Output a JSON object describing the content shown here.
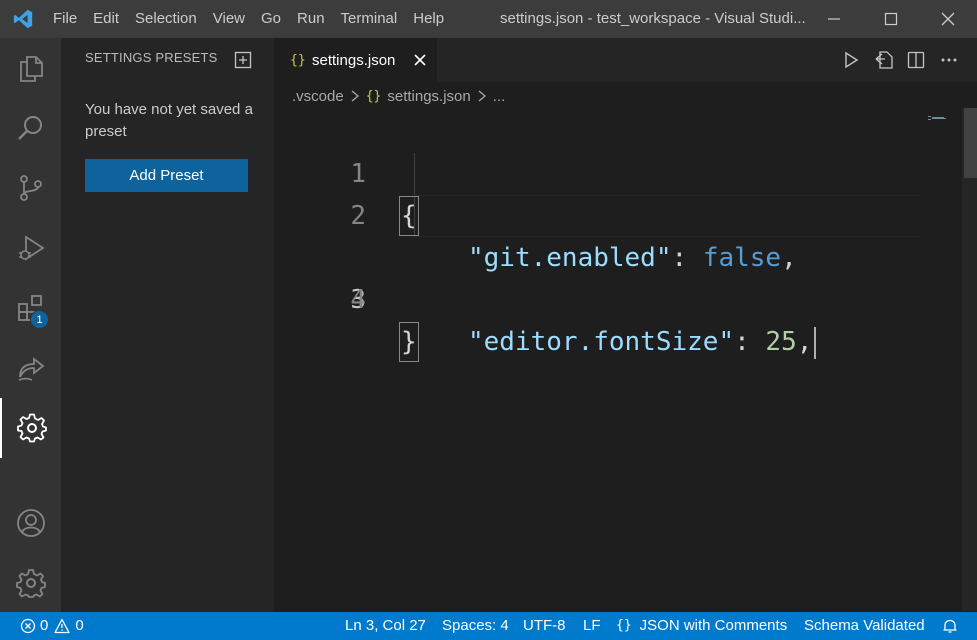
{
  "titlebar": {
    "menu": [
      "File",
      "Edit",
      "Selection",
      "View",
      "Go",
      "Run",
      "Terminal",
      "Help"
    ],
    "window_title": "settings.json - test_workspace - Visual Studi..."
  },
  "activitybar": {
    "items": [
      "explorer-icon",
      "search-icon",
      "source-control-icon",
      "run-debug-icon",
      "extensions-icon",
      "remote-share-icon",
      "settings-presets-icon"
    ],
    "extensions_badge": "1",
    "bottom": [
      "account-icon",
      "manage-gear-icon"
    ]
  },
  "sidebar": {
    "title": "SETTINGS PRESETS",
    "empty_message": "You have not yet saved a preset",
    "add_button": "Add Preset"
  },
  "editor": {
    "tab": {
      "icon_text": "{}",
      "label": "settings.json"
    },
    "breadcrumb": {
      "folder": ".vscode",
      "file_icon": "{}",
      "file": "settings.json",
      "more": "..."
    },
    "lines": [
      {
        "number": "1",
        "open": "{"
      },
      {
        "number": "2",
        "key": "\"git.enabled\"",
        "colon": ": ",
        "value": "false",
        "trail": ","
      },
      {
        "number": "3",
        "key": "\"editor.fontSize\"",
        "colon": ": ",
        "value": "25",
        "trail": ","
      },
      {
        "number": "4",
        "close": "}"
      }
    ],
    "current_line": 3
  },
  "statusbar": {
    "errors": "0",
    "warnings": "0",
    "position": "Ln 3, Col 27",
    "spaces": "Spaces: 4",
    "encoding": "UTF-8",
    "eol": "LF",
    "language_icon": "{}",
    "language": "JSON with Comments",
    "schema": "Schema Validated"
  },
  "colors": {
    "accent": "#007acc",
    "button": "#0e639c",
    "json_icon": "#cbcb41",
    "json_key": "#9cdcfe",
    "keyword": "#569cd6",
    "number": "#b5cea8"
  }
}
